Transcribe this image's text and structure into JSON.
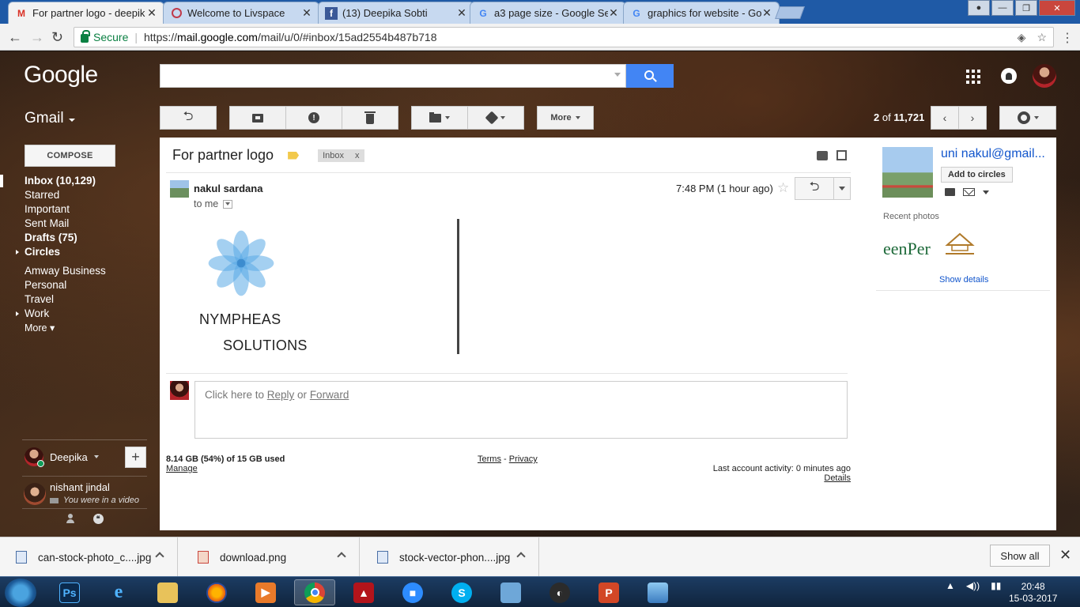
{
  "browser": {
    "tabs": [
      {
        "title": "For partner logo - deepik",
        "icon": "gmail-icon",
        "active": true
      },
      {
        "title": "Welcome to Livspace",
        "icon": "livspace-icon",
        "active": false
      },
      {
        "title": "(13) Deepika Sobti",
        "icon": "facebook-icon",
        "active": false
      },
      {
        "title": "a3 page size - Google Se",
        "icon": "google-icon",
        "active": false
      },
      {
        "title": "graphics for website - Go",
        "icon": "google-icon",
        "active": false
      }
    ],
    "secure_label": "Secure",
    "url_prefix": "https://",
    "url_host": "mail.google.com",
    "url_path": "/mail/u/0/#inbox/15ad2554b487b718"
  },
  "gmail": {
    "logo": "Google",
    "app_label": "Gmail",
    "toolbar": {
      "more_label": "More"
    },
    "pager": {
      "current": "2",
      "of_label": "of",
      "total": "11,721"
    },
    "compose_label": "COMPOSE",
    "nav": [
      {
        "label": "Inbox (10,129)",
        "bold": true,
        "selected": true
      },
      {
        "label": "Starred"
      },
      {
        "label": "Important"
      },
      {
        "label": "Sent Mail"
      },
      {
        "label": "Drafts (75)",
        "bold": true
      },
      {
        "label": "Circles",
        "bold": true,
        "expandable": true
      }
    ],
    "labels_nav": [
      {
        "label": "Amway Business"
      },
      {
        "label": "Personal"
      },
      {
        "label": "Travel"
      },
      {
        "label": "Work",
        "expandable": true
      },
      {
        "label": "More ▾"
      }
    ],
    "chat": {
      "me": "Deepika",
      "contact_name": "nishant jindal",
      "contact_status": "You were in a video"
    }
  },
  "email": {
    "subject": "For partner logo",
    "label_chip": "Inbox",
    "label_chip_close": "x",
    "sender": "nakul sardana",
    "to_line": "to me",
    "time": "7:48 PM (1 hour ago)",
    "signature_line1": "NYMPHEAS",
    "signature_line2": "SOLUTIONS",
    "reply_prompt_prefix": "Click here to ",
    "reply_link": "Reply",
    "reply_or": " or ",
    "forward_link": "Forward"
  },
  "footer": {
    "storage": "8.14 GB (54%) of 15 GB used",
    "manage": "Manage",
    "terms": "Terms",
    "dash": " - ",
    "privacy": "Privacy",
    "activity": "Last account activity: 0 minutes ago",
    "details": "Details"
  },
  "contact_panel": {
    "name": "uni nakul@gmail...",
    "add_circles": "Add to circles",
    "recent_photos": "Recent photos",
    "thumb_text": "eenPer",
    "show_details": "Show details"
  },
  "downloads": {
    "items": [
      "can-stock-photo_c....jpg",
      "download.png",
      "stock-vector-phon....jpg"
    ],
    "show_all": "Show all"
  },
  "taskbar": {
    "ps_label": "Ps",
    "time": "20:48",
    "date": "15-03-2017"
  },
  "colors": {
    "gmail_search_blue": "#4285f4",
    "link_blue": "#1155cc",
    "secure_green": "#0b8043",
    "flower_blue": "#5aa9e6"
  }
}
